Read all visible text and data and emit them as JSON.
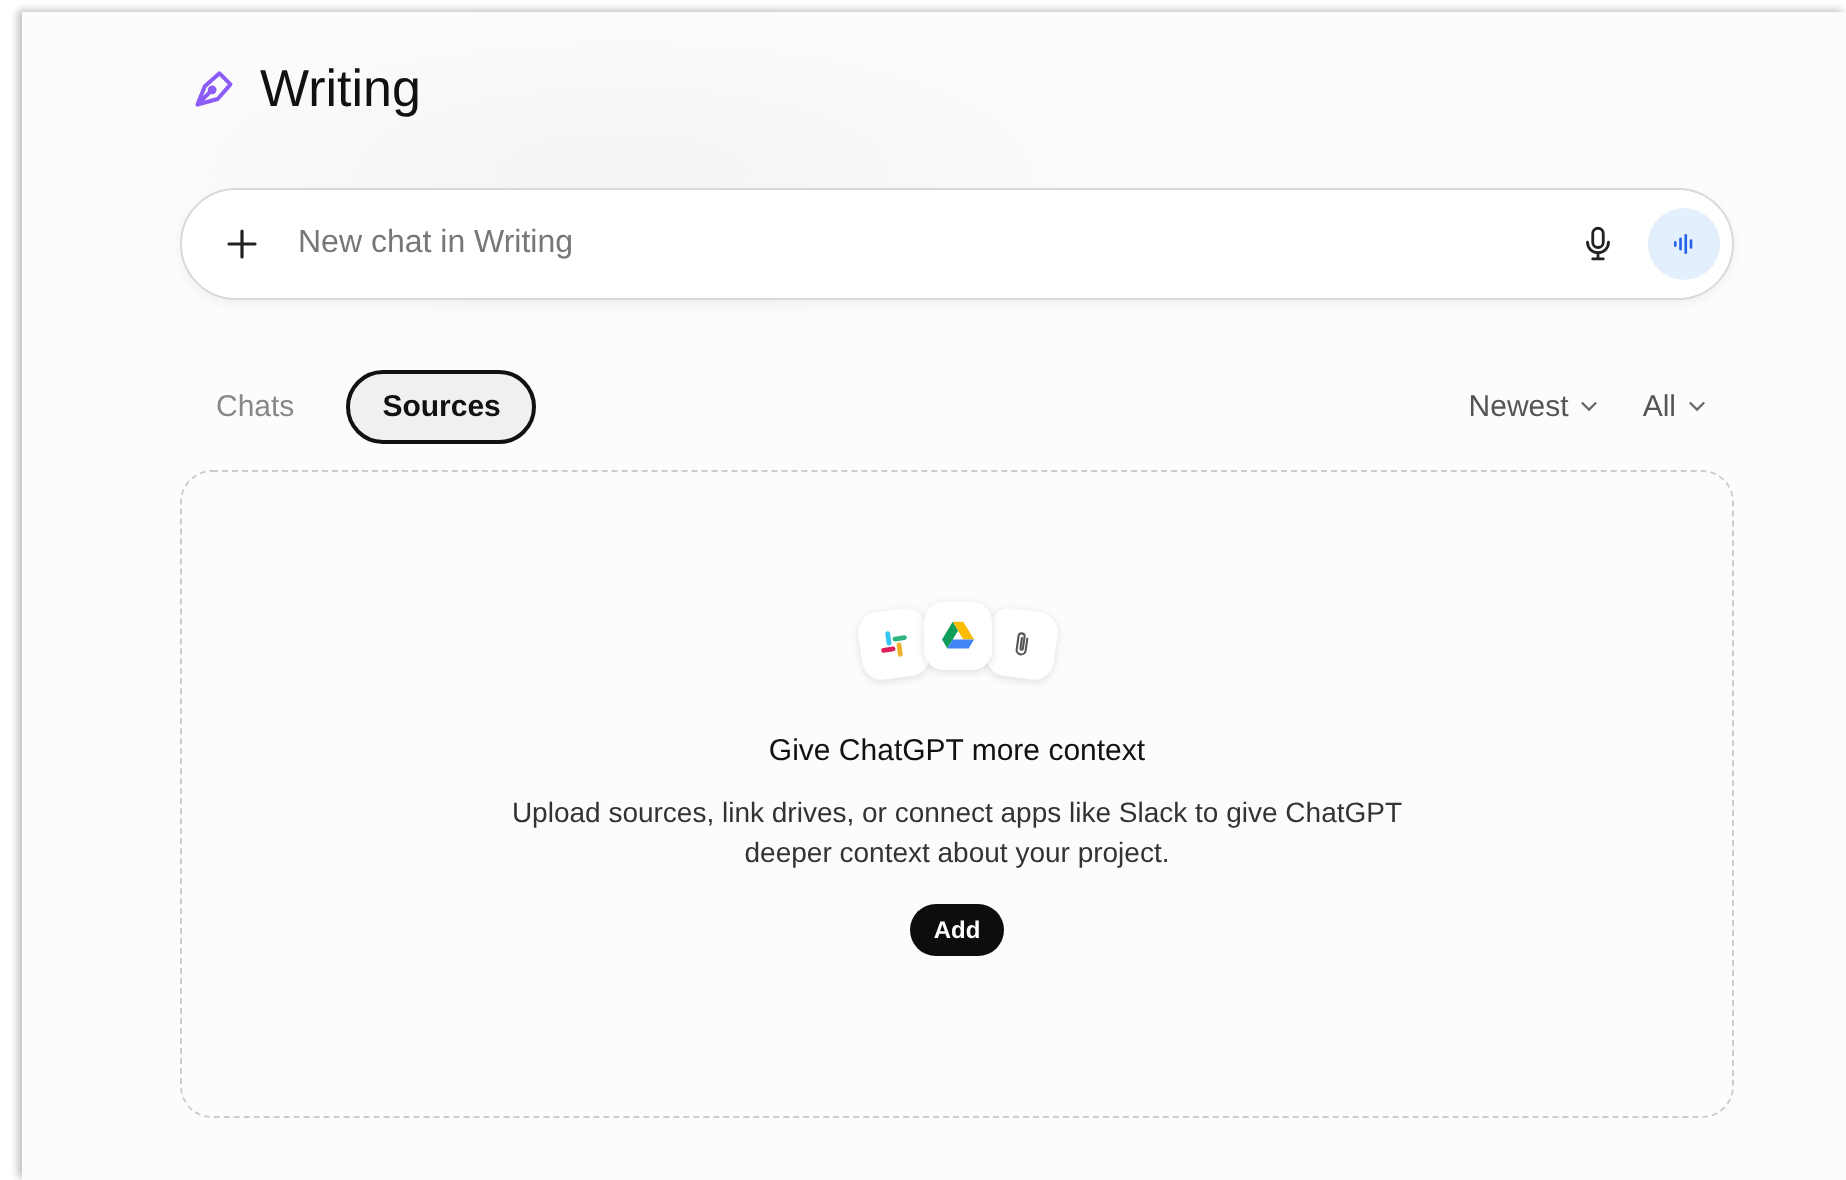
{
  "project": {
    "title": "Writing"
  },
  "composer": {
    "placeholder": "New chat in Writing"
  },
  "tabs": [
    {
      "label": "Chats",
      "selected": false
    },
    {
      "label": "Sources",
      "selected": true
    }
  ],
  "filters": [
    {
      "label": "Newest"
    },
    {
      "label": "All"
    }
  ],
  "empty_state": {
    "heading": "Give ChatGPT more context",
    "description": "Upload sources, link drives, or connect apps like Slack to give ChatGPT deeper context about your project.",
    "button": "Add"
  }
}
